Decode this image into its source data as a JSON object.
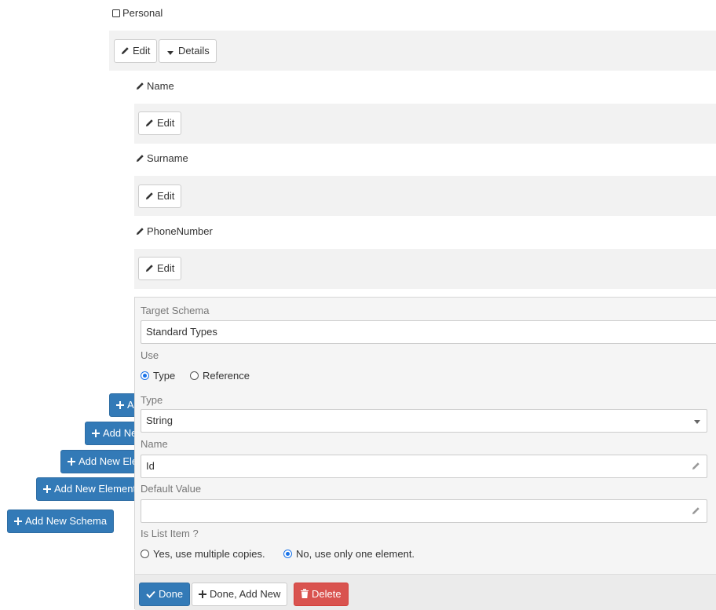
{
  "tree": {
    "root": {
      "label": "Personal",
      "edit_label": "Edit",
      "details_label": "Details"
    },
    "items": [
      {
        "label": "Name",
        "edit_label": "Edit"
      },
      {
        "label": "Surname",
        "edit_label": "Edit"
      },
      {
        "label": "PhoneNumber",
        "edit_label": "Edit"
      }
    ]
  },
  "form": {
    "target_schema_label": "Target Schema",
    "target_schema_value": "Standard Types",
    "use_label": "Use",
    "use_options": [
      {
        "label": "Type",
        "checked": true
      },
      {
        "label": "Reference",
        "checked": false
      }
    ],
    "type_label": "Type",
    "type_value": "String",
    "name_label": "Name",
    "name_value": "Id",
    "default_value_label": "Default Value",
    "default_value_value": "",
    "is_list_label": "Is List Item ?",
    "is_list_options": [
      {
        "label": "Yes, use multiple copies.",
        "checked": false
      },
      {
        "label": "No, use only one element.",
        "checked": true
      }
    ],
    "done_label": "Done",
    "done_add_new_label": "Done, Add New",
    "delete_label": "Delete"
  },
  "left_buttons": [
    {
      "label": "Add New Element"
    },
    {
      "label": "Add New Element"
    },
    {
      "label": "Add New Element"
    },
    {
      "label": "Add New Element"
    }
  ],
  "add_schema_label": "Add New Schema",
  "colors": {
    "primary": "#337ab7",
    "danger": "#d9534f",
    "band": "#f2f2f2",
    "radio_checked": "#1a73e8"
  }
}
